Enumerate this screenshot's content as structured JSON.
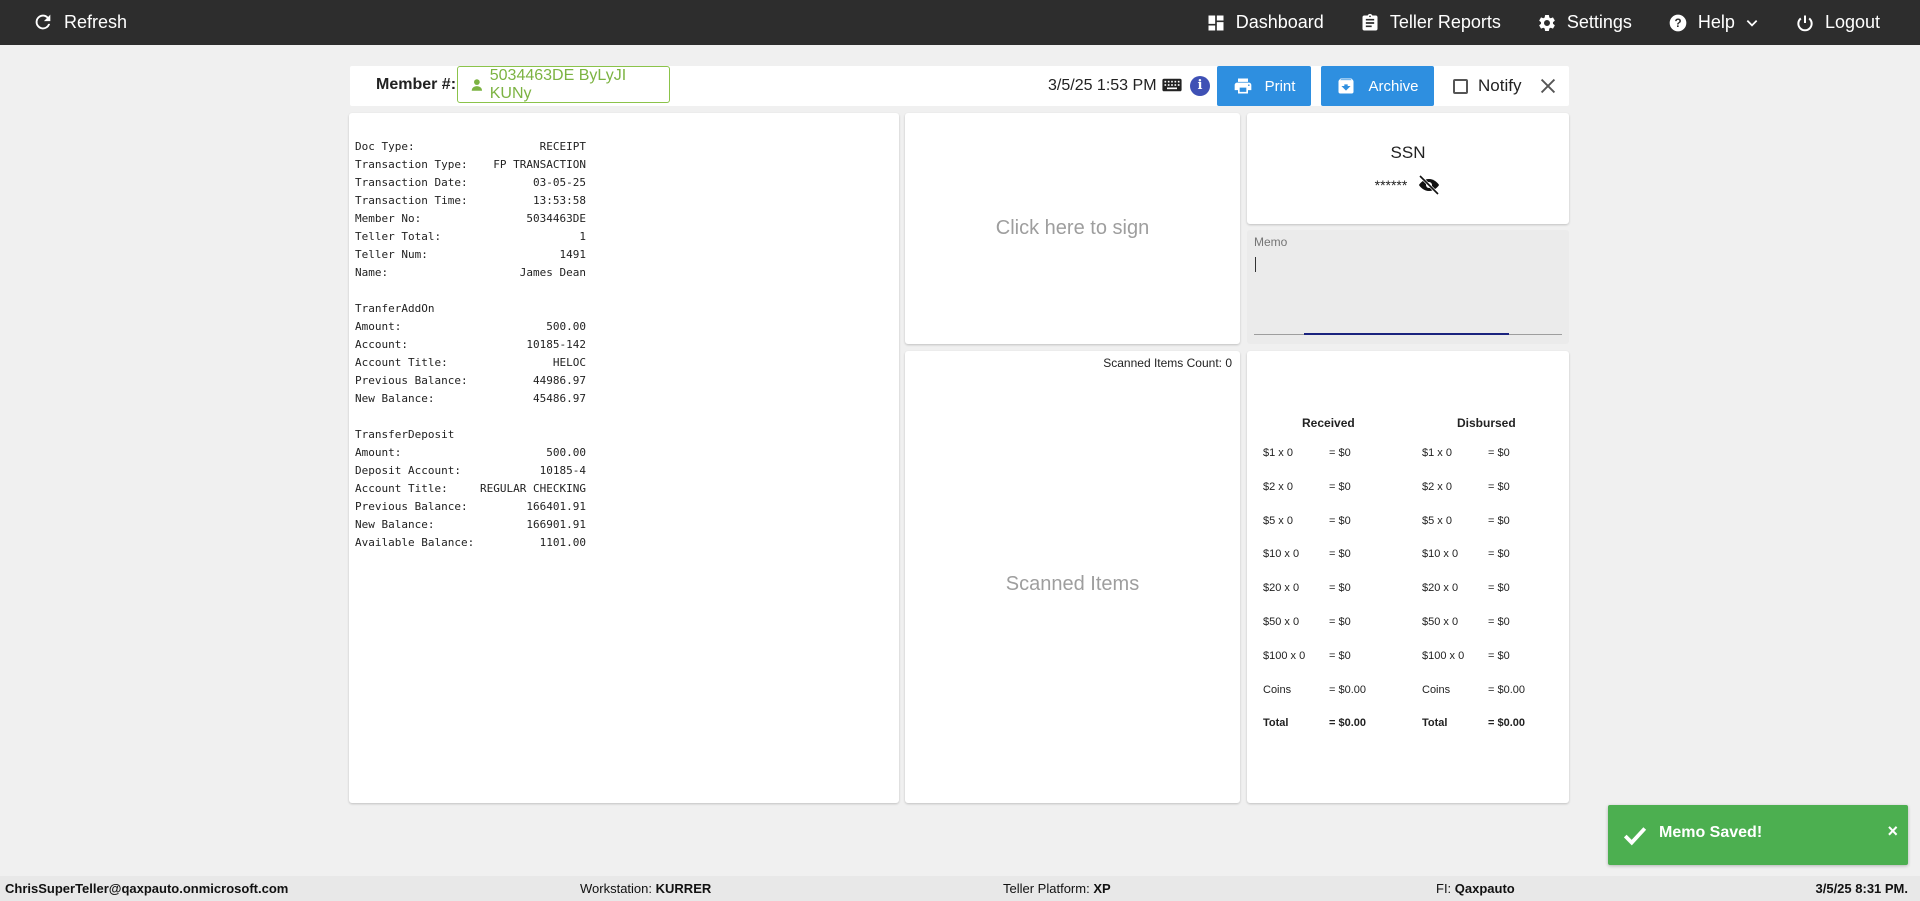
{
  "topbar": {
    "refresh_label": "Refresh",
    "dashboard_label": "Dashboard",
    "teller_reports_label": "Teller Reports",
    "settings_label": "Settings",
    "help_label": "Help",
    "logout_label": "Logout"
  },
  "member": {
    "label": "Member #:",
    "value": "5034463DE ByLyJI KUNy",
    "datetime": "3/5/25 1:53 PM",
    "print_label": "Print",
    "archive_label": "Archive",
    "notify_label": "Notify"
  },
  "receipt": {
    "header": [
      {
        "k": "Doc Type:",
        "v": "RECEIPT"
      },
      {
        "k": "Transaction Type:",
        "v": "FP TRANSACTION"
      },
      {
        "k": "Transaction Date:",
        "v": "03-05-25"
      },
      {
        "k": "Transaction Time:",
        "v": "13:53:58"
      },
      {
        "k": "Member No:",
        "v": "5034463DE"
      },
      {
        "k": "Teller Total:",
        "v": "1"
      },
      {
        "k": "Teller Num:",
        "v": "1491"
      },
      {
        "k": "Name:",
        "v": "James Dean"
      }
    ],
    "section1_title": "TranferAddOn",
    "section1": [
      {
        "k": "Amount:",
        "v": "500.00"
      },
      {
        "k": "Account:",
        "v": "10185-142"
      },
      {
        "k": "Account Title:",
        "v": "HELOC"
      },
      {
        "k": "Previous Balance:",
        "v": "44986.97"
      },
      {
        "k": "New Balance:",
        "v": "45486.97"
      }
    ],
    "section2_title": "TransferDeposit",
    "section2": [
      {
        "k": "Amount:",
        "v": "500.00"
      },
      {
        "k": "Deposit Account:",
        "v": "10185-4"
      },
      {
        "k": "Account Title:",
        "v": "REGULAR CHECKING"
      },
      {
        "k": "Previous Balance:",
        "v": "166401.91"
      },
      {
        "k": "New Balance:",
        "v": "166901.91"
      },
      {
        "k": "Available Balance:",
        "v": "1101.00"
      }
    ]
  },
  "sign": {
    "label": "Click here to sign"
  },
  "ssn": {
    "title": "SSN",
    "masked": "******"
  },
  "memo": {
    "label": "Memo",
    "value": ""
  },
  "scanned": {
    "count_label": "Scanned Items Count: 0",
    "placeholder": "Scanned Items"
  },
  "cash": {
    "received_label": "Received",
    "disbursed_label": "Disbursed",
    "received": [
      {
        "k": "$1 x 0",
        "v": "= $0"
      },
      {
        "k": "$2 x 0",
        "v": "= $0"
      },
      {
        "k": "$5 x 0",
        "v": "= $0"
      },
      {
        "k": "$10 x 0",
        "v": "= $0"
      },
      {
        "k": "$20 x 0",
        "v": "= $0"
      },
      {
        "k": "$50 x 0",
        "v": "= $0"
      },
      {
        "k": "$100 x 0",
        "v": "= $0"
      },
      {
        "k": "Coins",
        "v": "= $0.00"
      },
      {
        "k": "Total",
        "v": "= $0.00"
      }
    ],
    "disbursed": [
      {
        "k": "$1 x 0",
        "v": "= $0"
      },
      {
        "k": "$2 x 0",
        "v": "= $0"
      },
      {
        "k": "$5 x 0",
        "v": "= $0"
      },
      {
        "k": "$10 x 0",
        "v": "= $0"
      },
      {
        "k": "$20 x 0",
        "v": "= $0"
      },
      {
        "k": "$50 x 0",
        "v": "= $0"
      },
      {
        "k": "$100 x 0",
        "v": "= $0"
      },
      {
        "k": "Coins",
        "v": "= $0.00"
      },
      {
        "k": "Total",
        "v": "= $0.00"
      }
    ]
  },
  "toast": {
    "message": "Memo Saved!",
    "close": "×",
    "color": "#4caf50"
  },
  "status": {
    "user": "ChrisSuperTeller@qaxpauto.onmicrosoft.com",
    "workstation_label": "Workstation:",
    "workstation": "KURRER",
    "platform_label": "Teller Platform:",
    "platform": "XP",
    "fi_label": "FI:",
    "fi": "Qaxpauto",
    "datetime": "3/5/25 8:31 PM."
  },
  "colors": {
    "topbar": "#2d2d2d",
    "accent_blue": "#2e8fe0",
    "member_green": "#7cb342"
  }
}
